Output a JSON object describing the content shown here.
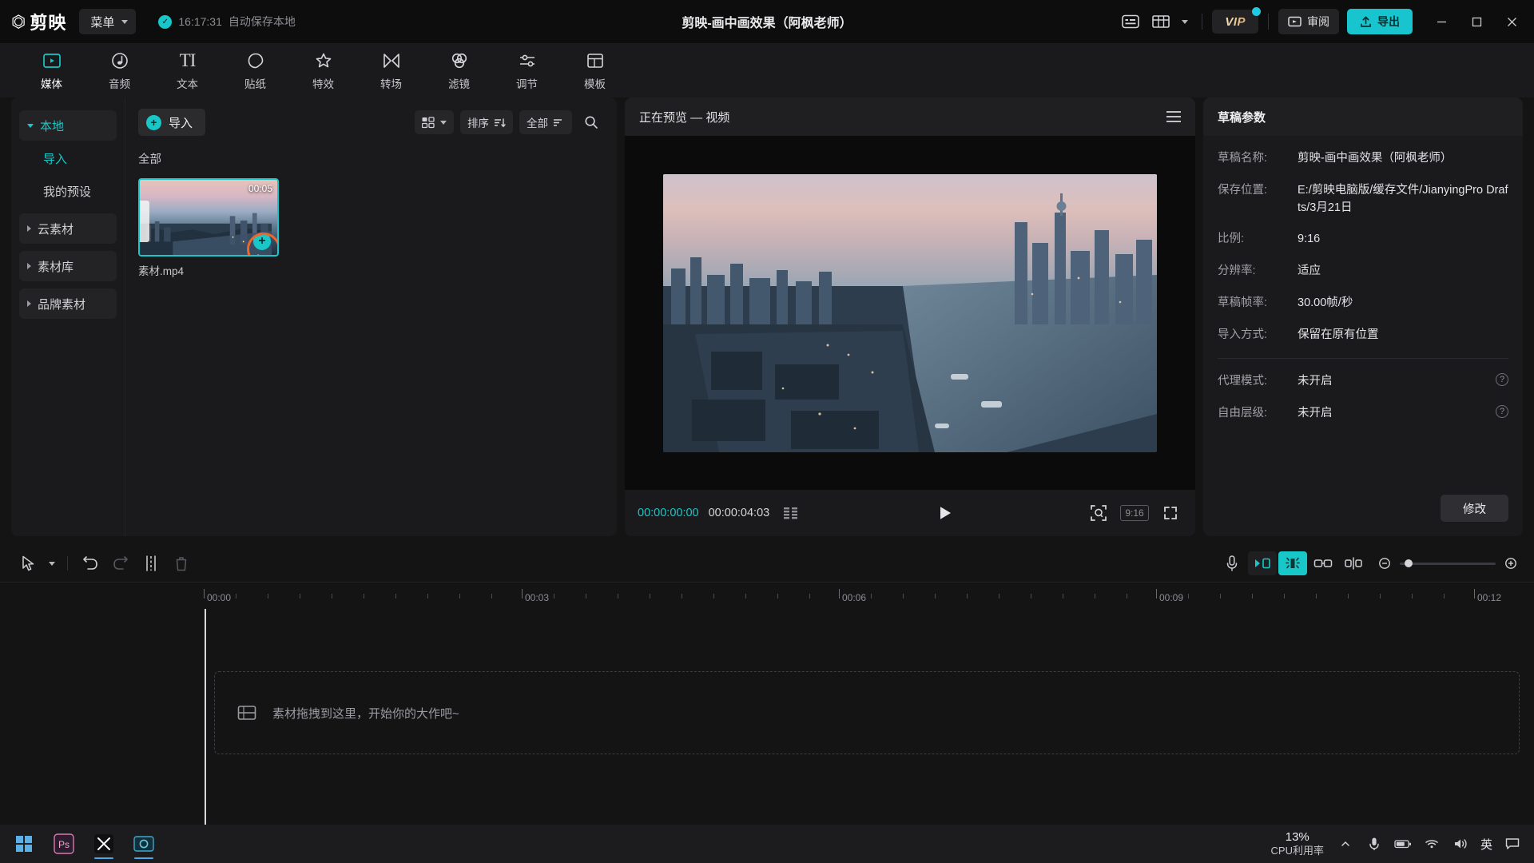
{
  "topbar": {
    "logo_text": "剪映",
    "menu_label": "菜单",
    "autosave_time": "16:17:31",
    "autosave_label": "自动保存本地",
    "project_title": "剪映-画中画效果（阿枫老师）",
    "vip_label": "VIP",
    "review_label": "审阅",
    "export_label": "导出",
    "icons": {
      "caption": "caption-icon",
      "layout": "layout-icon",
      "layout_caret": "chevron-down-icon",
      "review": "review-icon",
      "export": "export-icon",
      "minimize": "minimize-icon",
      "maximize": "maximize-icon",
      "close": "close-icon"
    }
  },
  "tabs": [
    {
      "label": "媒体",
      "icon": "media-icon",
      "active": true
    },
    {
      "label": "音频",
      "icon": "audio-icon",
      "active": false
    },
    {
      "label": "文本",
      "icon": "text-icon",
      "active": false
    },
    {
      "label": "贴纸",
      "icon": "sticker-icon",
      "active": false
    },
    {
      "label": "特效",
      "icon": "effects-icon",
      "active": false
    },
    {
      "label": "转场",
      "icon": "transition-icon",
      "active": false
    },
    {
      "label": "滤镜",
      "icon": "filter-icon",
      "active": false
    },
    {
      "label": "调节",
      "icon": "adjust-icon",
      "active": false
    },
    {
      "label": "模板",
      "icon": "template-icon",
      "active": false
    }
  ],
  "sidebar": {
    "items": [
      {
        "label": "本地",
        "type": "group",
        "expanded": true,
        "active": true
      },
      {
        "label": "导入",
        "type": "sub",
        "active": true
      },
      {
        "label": "我的预设",
        "type": "sub",
        "active": false
      },
      {
        "label": "云素材",
        "type": "group",
        "expanded": false,
        "active": false
      },
      {
        "label": "素材库",
        "type": "group",
        "expanded": false,
        "active": false
      },
      {
        "label": "品牌素材",
        "type": "group",
        "expanded": false,
        "active": false
      }
    ]
  },
  "media": {
    "import_label": "导入",
    "view_label": "grid-view-icon",
    "sort_label": "排序",
    "filter_label": "全部",
    "search_label": "search-icon",
    "section_label": "全部",
    "cards": [
      {
        "filename": "素材.mp4",
        "duration": "00:05",
        "selected": true
      }
    ]
  },
  "preview": {
    "header_label": "正在预览 — 视频",
    "current_time": "00:00:00:00",
    "total_time": "00:00:04:03",
    "ratio_badge": "9:16",
    "icons": {
      "menu": "hamburger-icon",
      "frames": "frames-icon",
      "play": "play-icon",
      "focus": "focus-icon",
      "fullscreen": "fullscreen-icon"
    }
  },
  "draft": {
    "title": "草稿参数",
    "rows": [
      {
        "label": "草稿名称:",
        "value": "剪映-画中画效果（阿枫老师）",
        "help": false
      },
      {
        "label": "保存位置:",
        "value": "E:/剪映电脑版/缓存文件/JianyingPro Drafts/3月21日",
        "help": false
      },
      {
        "label": "比例:",
        "value": "9:16",
        "help": false
      },
      {
        "label": "分辨率:",
        "value": "适应",
        "help": false
      },
      {
        "label": "草稿帧率:",
        "value": "30.00帧/秒",
        "help": false
      },
      {
        "label": "导入方式:",
        "value": "保留在原有位置",
        "help": false
      }
    ],
    "rows2": [
      {
        "label": "代理模式:",
        "value": "未开启",
        "help": true
      },
      {
        "label": "自由层级:",
        "value": "未开启",
        "help": true
      }
    ],
    "modify_label": "修改"
  },
  "timeline": {
    "tools": [
      {
        "name": "select-tool-icon",
        "state": "normal"
      },
      {
        "name": "select-caret-icon",
        "state": "normal"
      },
      {
        "name": "undo-icon",
        "state": "normal"
      },
      {
        "name": "redo-icon",
        "state": "disabled"
      },
      {
        "name": "split-icon",
        "state": "normal"
      },
      {
        "name": "delete-icon",
        "state": "disabled"
      }
    ],
    "right_tools": [
      {
        "name": "microphone-icon",
        "state": "normal"
      },
      {
        "name": "mirror-icon",
        "state": "on"
      },
      {
        "name": "magnet-icon",
        "state": "onfill"
      },
      {
        "name": "link-icon",
        "state": "normal"
      },
      {
        "name": "keyframe-icon",
        "state": "normal"
      }
    ],
    "ruler_labels": [
      "00:00",
      "00:03",
      "00:06",
      "00:09",
      "00:12"
    ],
    "drop_hint": "素材拖拽到这里，开始你的大作吧~",
    "drop_icon": "clip-icon"
  },
  "taskbar": {
    "apps": [
      {
        "name": "start-icon",
        "active": false
      },
      {
        "name": "photoshop-icon",
        "active": false
      },
      {
        "name": "jianying-icon",
        "active": true
      },
      {
        "name": "recorder-icon",
        "active": true
      }
    ],
    "cpu_percent": "13%",
    "cpu_label": "CPU利用率",
    "ime_label": "英",
    "tray": [
      {
        "name": "chevron-up-icon"
      },
      {
        "name": "microphone-tray-icon"
      },
      {
        "name": "battery-icon"
      },
      {
        "name": "wifi-icon"
      },
      {
        "name": "volume-icon"
      },
      {
        "name": "notification-icon"
      }
    ]
  }
}
